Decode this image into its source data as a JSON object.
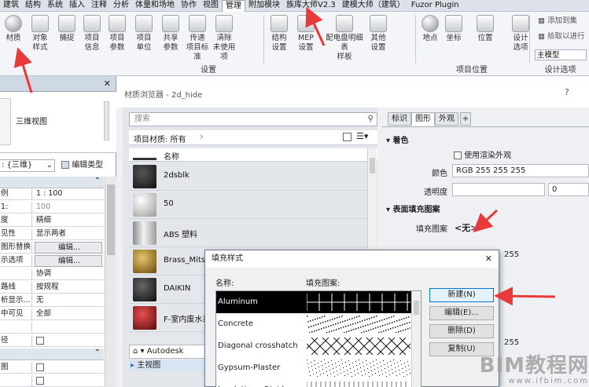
{
  "menubar": {
    "items": [
      "建筑",
      "结构",
      "系统",
      "插入",
      "注释",
      "分析",
      "体量和场地",
      "协作",
      "视图",
      "管理",
      "附加模块",
      "族库大师V2.3",
      "建模大师（建筑）",
      "Fuzor Plugin"
    ],
    "active_index": 9
  },
  "ribbon": {
    "buttons": [
      "材质",
      "对象\n样式",
      "捕捉",
      "项目\n信息",
      "项目\n参数",
      "项目\n单位",
      "共享\n参数",
      "传递\n项目标准",
      "清除\n未使用项",
      "结构\n设置",
      "MEP\n设置",
      "配电盘明细表\n样板",
      "其他\n设置",
      "地点",
      "坐标",
      "位置",
      "设计\n选项"
    ],
    "panel_settings": "设置",
    "panel_location": "项目位置",
    "panel_design": "设计选项",
    "add_to_set": "添加到集",
    "pick_to_edit": "拾取以进行",
    "main_model": "主模型"
  },
  "properties": {
    "view_type": "三维视图",
    "view_select": ": {三维}",
    "edit_type": "编辑类型",
    "rows": [
      {
        "k": "例",
        "v": "1 : 100",
        "kind": "text"
      },
      {
        "k": "1:",
        "v": "100",
        "kind": "grey"
      },
      {
        "k": "度",
        "v": "精细",
        "kind": "text"
      },
      {
        "k": "见性",
        "v": "显示两者",
        "kind": "text"
      },
      {
        "k": "图形替换",
        "v": "编辑...",
        "kind": "btn"
      },
      {
        "k": "示选项",
        "v": "编辑...",
        "kind": "btn"
      },
      {
        "k": "",
        "v": "协调",
        "kind": "text"
      },
      {
        "k": "路线",
        "v": "按规程",
        "kind": "text"
      },
      {
        "k": "析显示...",
        "v": "无",
        "kind": "text"
      },
      {
        "k": "中可见",
        "v": "全部",
        "kind": "text"
      },
      {
        "k": "",
        "v": "",
        "kind": "text"
      },
      {
        "k": "径",
        "v": "",
        "kind": "check"
      },
      {
        "k": "",
        "v": "",
        "kind": "group"
      },
      {
        "k": "图",
        "v": "",
        "kind": "check"
      },
      {
        "k": "",
        "v": "",
        "kind": "check"
      }
    ]
  },
  "material_browser": {
    "title": "材质浏览器 - 2d_hide",
    "help": "?",
    "search_placeholder": "搜索",
    "filter": "项目材质: 所有",
    "column_name": "名称",
    "materials": [
      "2dsblk",
      "50",
      "ABS 塑料",
      "Brass_Mitsu",
      "DAIKIN",
      "F-室内废水系"
    ],
    "library": "Autodesk",
    "main_view": "主视图",
    "tabs": [
      "标识",
      "图形",
      "外观"
    ],
    "add_tab": "+",
    "section_color": "着色",
    "use_render": "使用渲染外观",
    "color_label": "颜色",
    "color_value": "RGB 255 255 255",
    "transparency_label": "透明度",
    "transparency_value": "0",
    "section_surface": "表面填充图案",
    "fill_label": "填充图案",
    "fill_value": "<无>",
    "rgb_repeat": "255",
    "rgb_repeat2": "255"
  },
  "fill_dialog": {
    "title": "填充样式",
    "close": "✕",
    "col_name": "名称:",
    "col_pattern": "填充图案:",
    "patterns": [
      "Aluminum",
      "Concrete",
      "Diagonal crosshatch",
      "Gypsum-Plaster",
      "Insulation - Rigid"
    ],
    "buttons": [
      "新建(N)",
      "编辑(E)...",
      "删除(D)",
      "复制(U)"
    ]
  },
  "watermark": {
    "text": "BIM教程网",
    "url": "www.ifbim.com"
  },
  "colors": {
    "arrow": "#e83a3a",
    "accent": "#0078d7",
    "selected_row": "#000000"
  }
}
